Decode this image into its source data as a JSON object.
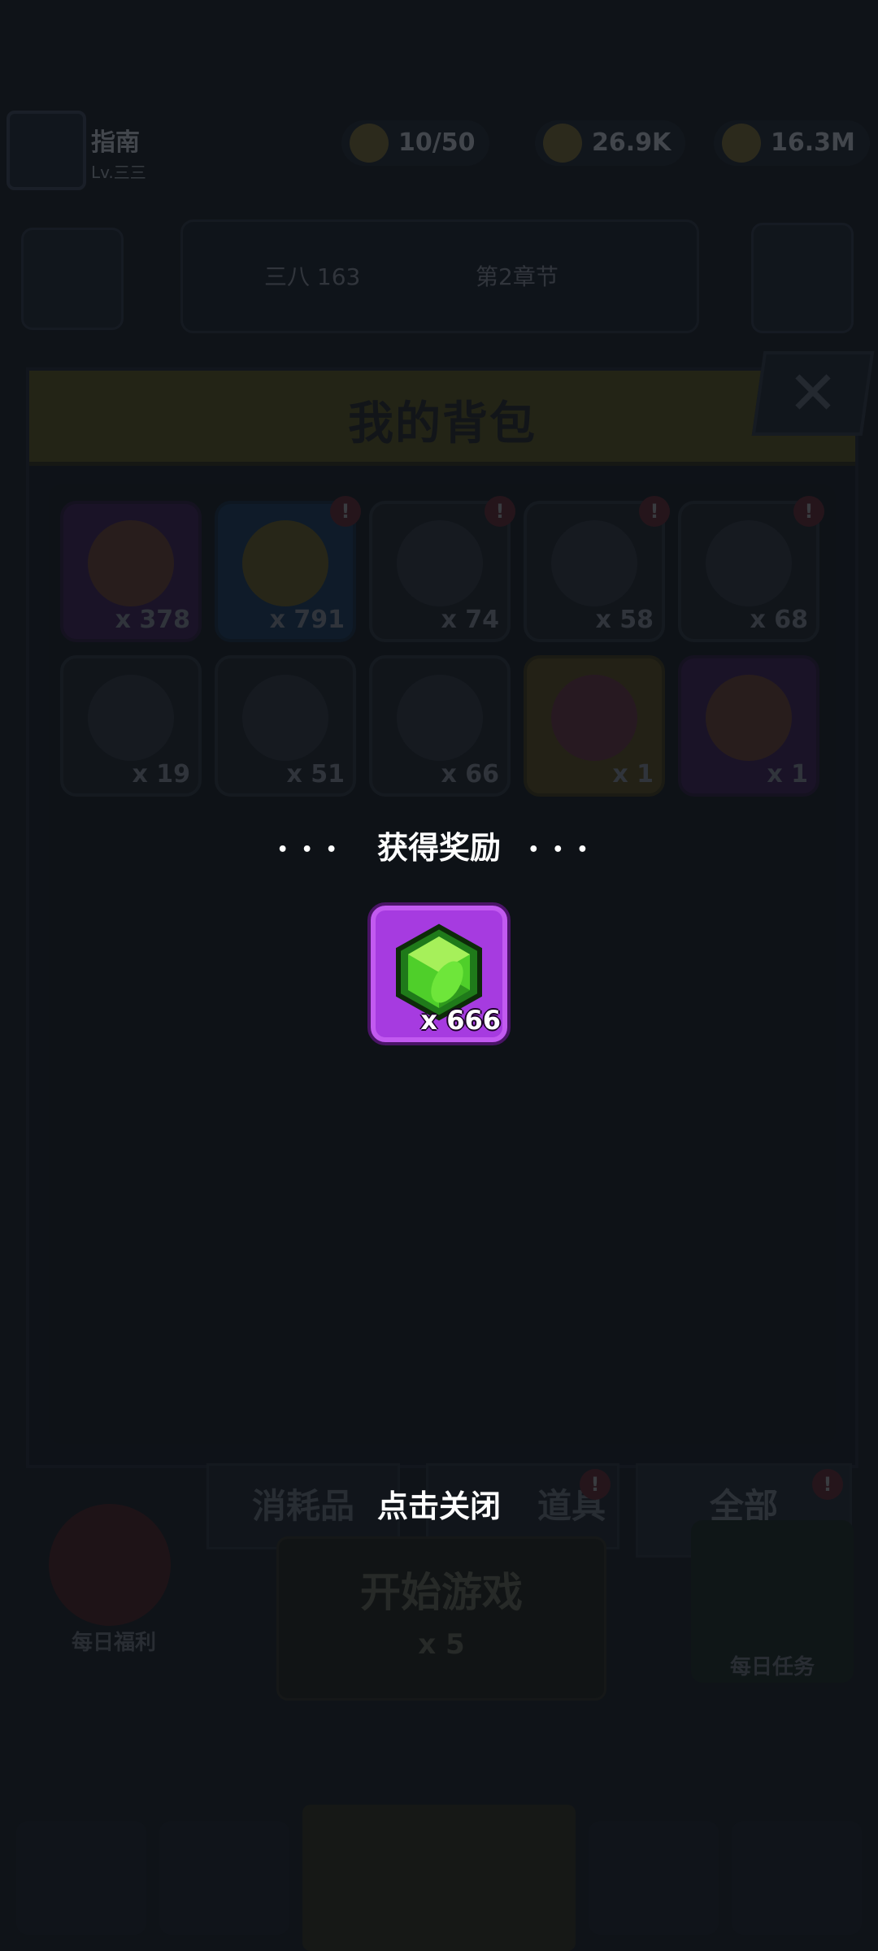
{
  "hud": {
    "player_name": "指南",
    "player_sub": "Lv.三三",
    "stats": [
      {
        "value": "10/50",
        "icon": "energy-icon"
      },
      {
        "value": "26.9K",
        "icon": "gold-coin-icon"
      },
      {
        "value": "16.3M",
        "icon": "coin-bag-icon"
      }
    ],
    "middle_label_a": "三八 163",
    "middle_label_b": "第2章节"
  },
  "backpack": {
    "title": "我的背包",
    "items": [
      {
        "count": "x 378",
        "style": "purple",
        "icon": "heart-icon",
        "badge": false
      },
      {
        "count": "x 791",
        "style": "blue",
        "icon": "flame-icon",
        "badge": true
      },
      {
        "count": "x 74",
        "style": "gray",
        "icon": "gun-scroll-icon",
        "badge": true
      },
      {
        "count": "x 58",
        "style": "gray",
        "icon": "shirt-scroll-icon",
        "badge": true
      },
      {
        "count": "x 68",
        "style": "gray",
        "icon": "necklace-scroll-icon",
        "badge": true
      },
      {
        "count": "x 19",
        "style": "gray",
        "icon": "belt-scroll-icon",
        "badge": false
      },
      {
        "count": "x 51",
        "style": "gray",
        "icon": "glove-scroll-icon",
        "badge": false
      },
      {
        "count": "x 66",
        "style": "gray",
        "icon": "boot-scroll-icon",
        "badge": false
      },
      {
        "count": "x 1",
        "style": "gold",
        "icon": "chest-icon",
        "badge": false
      },
      {
        "count": "x 1",
        "style": "purple",
        "icon": "armor-chest-icon",
        "badge": false
      }
    ],
    "tabs": {
      "consumables": "消耗品",
      "props": "道具",
      "all": "全部"
    }
  },
  "bottom": {
    "daily_label": "每日福利",
    "center_title": "开始游戏",
    "center_sub": "x 5",
    "right_label": "每日任务"
  },
  "reward": {
    "title": "获得奖励",
    "item_icon": "green-gem-icon",
    "item_count": "x 666",
    "tap_to_close": "点击关闭"
  }
}
